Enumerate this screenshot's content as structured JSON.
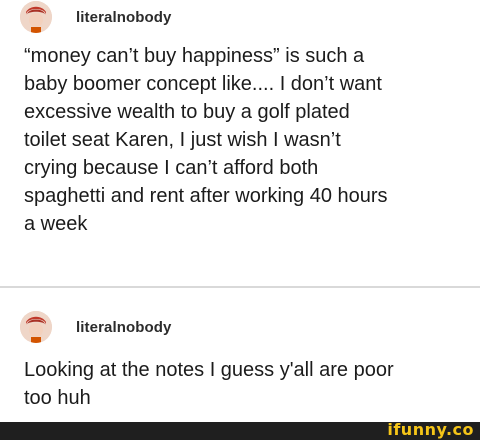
{
  "posts": [
    {
      "username": "literalnobody",
      "avatar_icon": "avatar-illustration",
      "text": "“money can’t buy happiness” is such a\nbaby boomer concept like.... I don’t want\nexcessive wealth to buy a golf plated\ntoilet seat Karen, I just wish I wasn’t\ncrying because I can’t afford both\nspaghetti and rent after working 40 hours\na week"
    },
    {
      "username": "literalnobody",
      "avatar_icon": "avatar-illustration",
      "text": "Looking at the notes I guess y'all are poor\ntoo huh"
    }
  ],
  "watermark": "ifunny.co",
  "colors": {
    "background": "#ffffff",
    "text": "#1b1b1b",
    "divider": "#d9d9d9",
    "watermark": "#f5c518",
    "footer": "#1f1f1f"
  }
}
